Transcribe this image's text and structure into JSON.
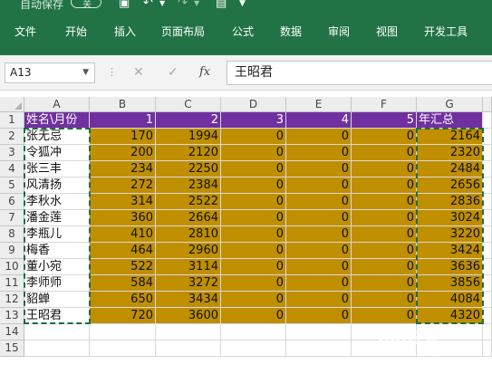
{
  "quick_access": {
    "autosave_label": "自动保存",
    "autosave_state": "关",
    "save_icon": "save-icon",
    "undo_icon": "undo-icon",
    "redo_icon": "redo-icon",
    "more_icon": "customize-qat-icon"
  },
  "ribbon_tabs": [
    "文件",
    "开始",
    "插入",
    "页面布局",
    "公式",
    "数据",
    "审阅",
    "视图",
    "开发工具"
  ],
  "formula_bar": {
    "name_box": "A13",
    "cancel_icon": "cancel-icon",
    "enter_icon": "checkmark-icon",
    "function_label": "fx",
    "content": "王昭君"
  },
  "columns": [
    "A",
    "B",
    "C",
    "D",
    "E",
    "F",
    "G"
  ],
  "rows": [
    "1",
    "2",
    "3",
    "4",
    "5",
    "6",
    "7",
    "8",
    "9",
    "10",
    "11",
    "12",
    "13",
    "14",
    "15"
  ],
  "header": [
    "姓名\\月份",
    "1",
    "2",
    "3",
    "4",
    "5",
    "年汇总"
  ],
  "data_rows": [
    [
      "张无忌",
      "170",
      "1994",
      "0",
      "0",
      "0",
      "2164"
    ],
    [
      "令狐冲",
      "200",
      "2120",
      "0",
      "0",
      "0",
      "2320"
    ],
    [
      "张三丰",
      "234",
      "2250",
      "0",
      "0",
      "0",
      "2484"
    ],
    [
      "风清扬",
      "272",
      "2384",
      "0",
      "0",
      "0",
      "2656"
    ],
    [
      "李秋水",
      "314",
      "2522",
      "0",
      "0",
      "0",
      "2836"
    ],
    [
      "潘金莲",
      "360",
      "2664",
      "0",
      "0",
      "0",
      "3024"
    ],
    [
      "李瓶儿",
      "410",
      "2810",
      "0",
      "0",
      "0",
      "3220"
    ],
    [
      "梅香",
      "464",
      "2960",
      "0",
      "0",
      "0",
      "3424"
    ],
    [
      "董小宛",
      "522",
      "3114",
      "0",
      "0",
      "0",
      "3636"
    ],
    [
      "李师师",
      "584",
      "3272",
      "0",
      "0",
      "0",
      "3856"
    ],
    [
      "貂蝉",
      "650",
      "3434",
      "0",
      "0",
      "0",
      "4084"
    ],
    [
      "王昭君",
      "720",
      "3600",
      "0",
      "0",
      "0",
      "4320"
    ]
  ],
  "colors": {
    "ribbon": "#217346",
    "header_fill": "#7030a0",
    "data_fill": "#bf8f00",
    "copy_marquee": "#1e6b45"
  },
  "watermark": "Bai经验",
  "watermark_sub": "jingyan.baidu.com"
}
